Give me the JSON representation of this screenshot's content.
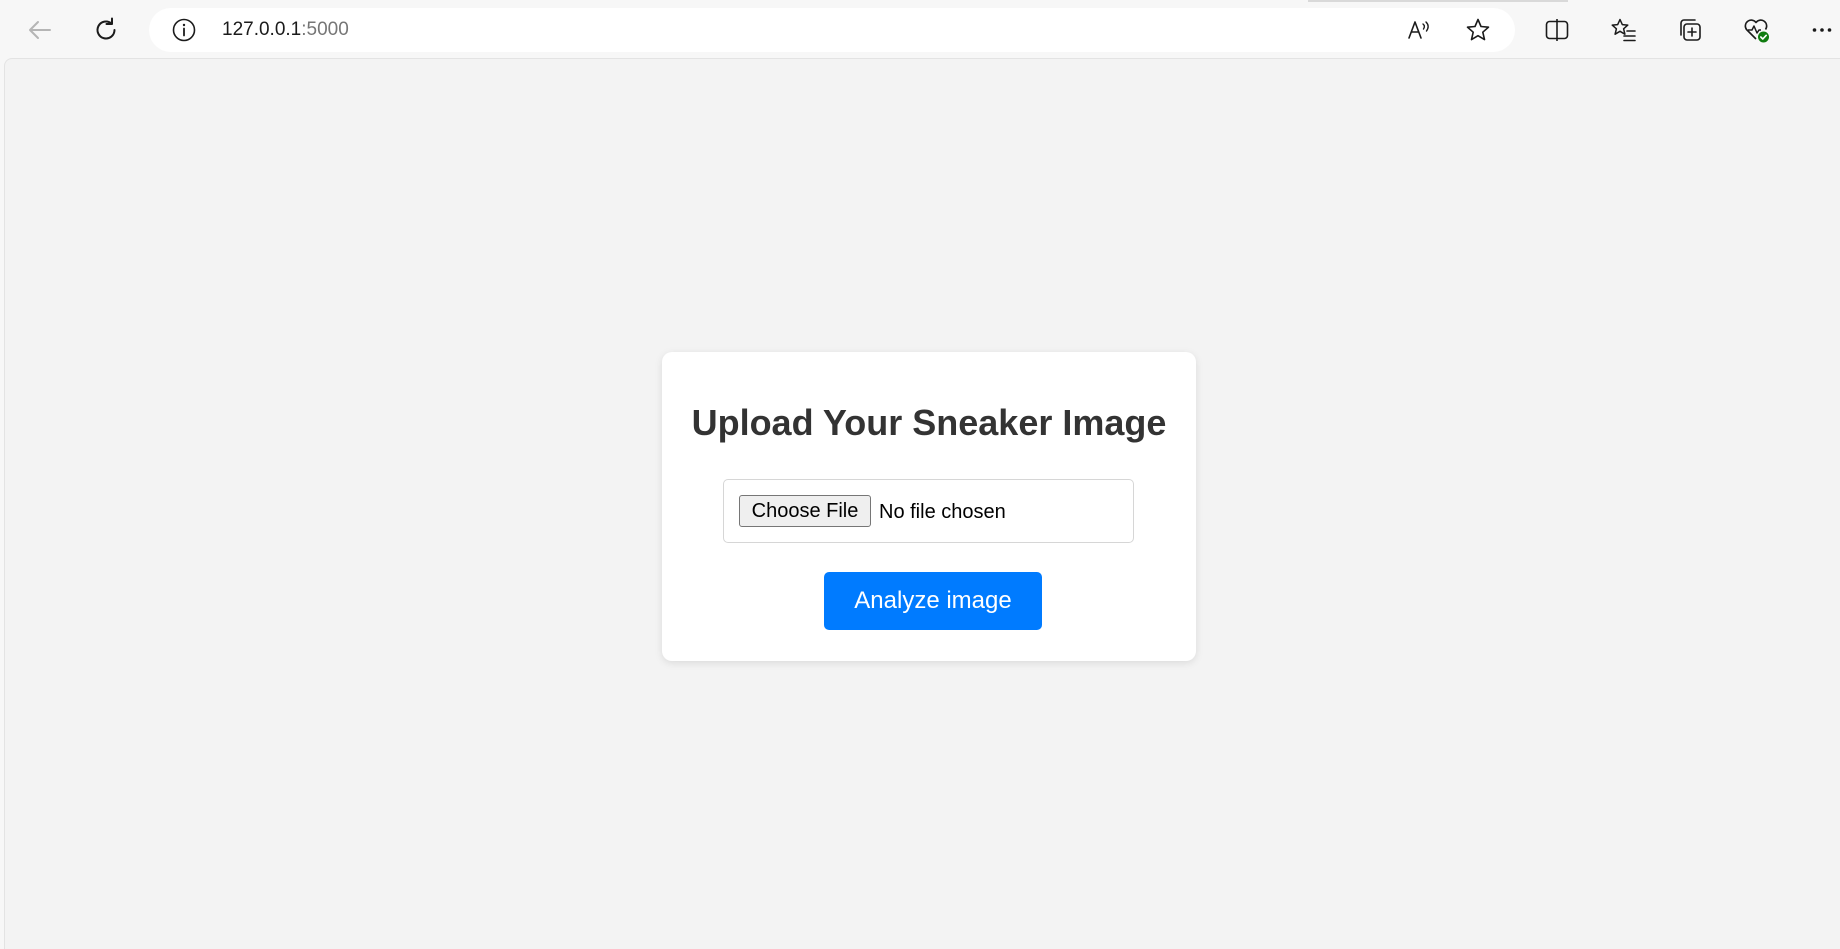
{
  "browser": {
    "url_host": "127.0.0.1",
    "url_port": ":5000",
    "toolbar_icons": [
      "back-arrow-icon",
      "refresh-icon",
      "site-info-icon",
      "read-aloud-icon",
      "favorite-star-icon",
      "split-screen-icon",
      "favorites-list-icon",
      "collections-icon",
      "browser-essentials-icon",
      "more-options-icon"
    ]
  },
  "page": {
    "title": "Upload Your Sneaker Image",
    "file_input": {
      "button_label": "Choose File",
      "status": "No file chosen"
    },
    "submit_label": "Analyze image",
    "colors": {
      "accent": "#007bff",
      "background": "#f3f3f3",
      "card": "#ffffff",
      "heading": "#333333",
      "status_badge": "#107c10"
    }
  }
}
